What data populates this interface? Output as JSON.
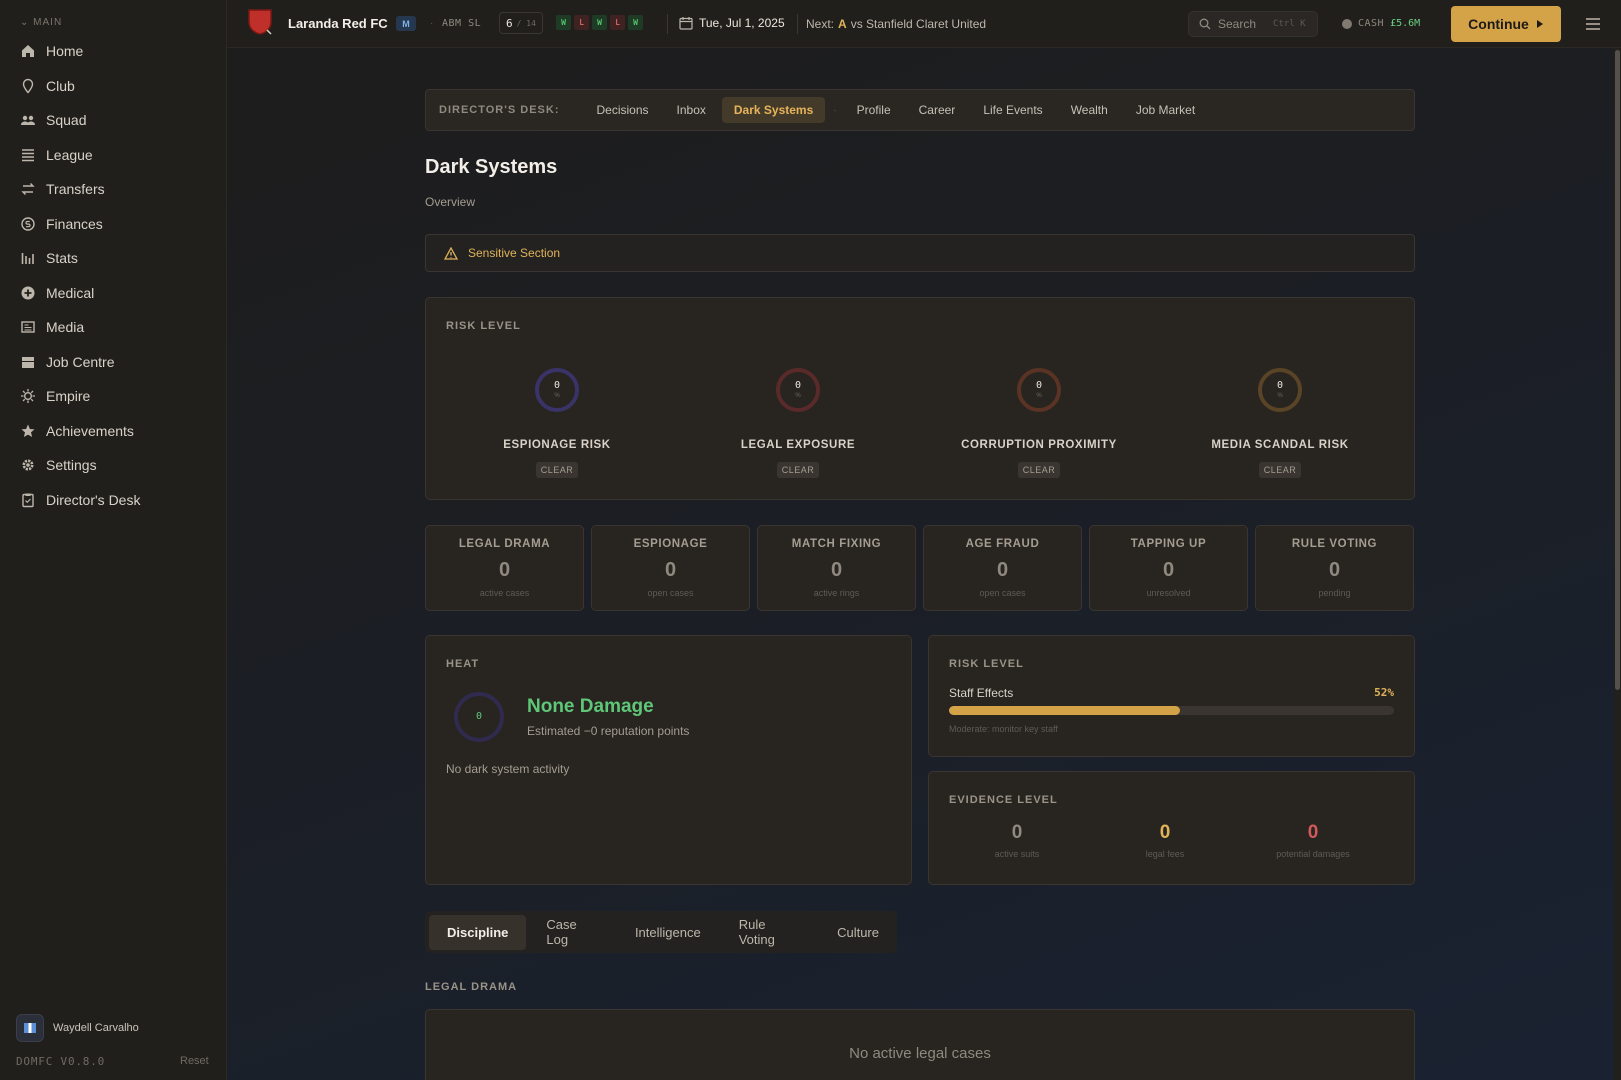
{
  "sidebar": {
    "section": "MAIN",
    "items": [
      {
        "label": "Home",
        "icon": "home-icon"
      },
      {
        "label": "Club",
        "icon": "map-pin-icon"
      },
      {
        "label": "Squad",
        "icon": "users-icon"
      },
      {
        "label": "League",
        "icon": "list-icon"
      },
      {
        "label": "Transfers",
        "icon": "swap-icon"
      },
      {
        "label": "Finances",
        "icon": "coin-icon"
      },
      {
        "label": "Stats",
        "icon": "bar-chart-icon"
      },
      {
        "label": "Medical",
        "icon": "medical-plus-icon"
      },
      {
        "label": "Media",
        "icon": "newspaper-icon"
      },
      {
        "label": "Job Centre",
        "icon": "briefcase-icon"
      },
      {
        "label": "Empire",
        "icon": "sun-icon"
      },
      {
        "label": "Achievements",
        "icon": "star-icon"
      },
      {
        "label": "Settings",
        "icon": "gear-icon"
      },
      {
        "label": "Director's Desk",
        "icon": "clipboard-icon"
      }
    ],
    "user_name": "Waydell Carvalho",
    "version": "DOMFC V0.8.0",
    "reset_label": "Reset"
  },
  "topbar": {
    "club_name": "Laranda Red FC",
    "manager_badge": "M",
    "league": "ABM SL",
    "position": "6",
    "position_total": "/ 14",
    "form": [
      "W",
      "L",
      "W",
      "L",
      "W"
    ],
    "date": "Tue, Jul 1, 2025",
    "next_label": "Next:",
    "next_venue": "A",
    "next_opponent": "vs Stanfield Claret United",
    "search_placeholder": "Search",
    "search_shortcut": "Ctrl K",
    "cash_label": "CASH",
    "cash_value": "£5.6M",
    "continue_label": "Continue"
  },
  "desk_nav": {
    "title": "DIRECTOR'S DESK:",
    "tabs_left": [
      "Decisions",
      "Inbox",
      "Dark Systems"
    ],
    "tabs_right": [
      "Profile",
      "Career",
      "Life Events",
      "Wealth",
      "Job Market"
    ],
    "active": "Dark Systems"
  },
  "page": {
    "title": "Dark Systems",
    "subtitle": "Overview",
    "alert": "Sensitive Section"
  },
  "risk_level": {
    "heading": "RISK LEVEL",
    "gauges": [
      {
        "label": "ESPIONAGE RISK",
        "value": "0",
        "unit": "%",
        "status": "CLEAR",
        "color": "#3a3368"
      },
      {
        "label": "LEGAL EXPOSURE",
        "value": "0",
        "unit": "%",
        "status": "CLEAR",
        "color": "#5a2a2a"
      },
      {
        "label": "CORRUPTION PROXIMITY",
        "value": "0",
        "unit": "%",
        "status": "CLEAR",
        "color": "#5a3325"
      },
      {
        "label": "MEDIA SCANDAL RISK",
        "value": "0",
        "unit": "%",
        "status": "CLEAR",
        "color": "#5a4426"
      }
    ]
  },
  "stats": [
    {
      "label": "LEGAL DRAMA",
      "value": "0",
      "sub": "active cases"
    },
    {
      "label": "ESPIONAGE",
      "value": "0",
      "sub": "open cases"
    },
    {
      "label": "MATCH FIXING",
      "value": "0",
      "sub": "active rings"
    },
    {
      "label": "AGE FRAUD",
      "value": "0",
      "sub": "open cases"
    },
    {
      "label": "TAPPING UP",
      "value": "0",
      "sub": "unresolved"
    },
    {
      "label": "RULE VOTING",
      "value": "0",
      "sub": "pending"
    }
  ],
  "heat": {
    "heading": "HEAT",
    "value": "0",
    "title": "None Damage",
    "subtitle": "Estimated −0 reputation points",
    "note": "No dark system activity"
  },
  "staff_risk": {
    "heading": "RISK LEVEL",
    "label": "Staff Effects",
    "percent_text": "52%",
    "fraction": 0.52,
    "note": "Moderate: monitor key staff"
  },
  "evidence": {
    "heading": "EVIDENCE LEVEL",
    "items": [
      {
        "value": "0",
        "label": "active suits",
        "color": "#8f897f"
      },
      {
        "value": "0",
        "label": "legal fees",
        "color": "#e0b35a"
      },
      {
        "value": "0",
        "label": "potential damages",
        "color": "#d05a5a"
      }
    ]
  },
  "sub_tabs": {
    "items": [
      "Discipline",
      "Case Log",
      "Intelligence",
      "Rule Voting",
      "Culture"
    ],
    "active": "Discipline"
  },
  "legal": {
    "heading": "LEGAL DRAMA",
    "empty": "No active legal cases"
  }
}
